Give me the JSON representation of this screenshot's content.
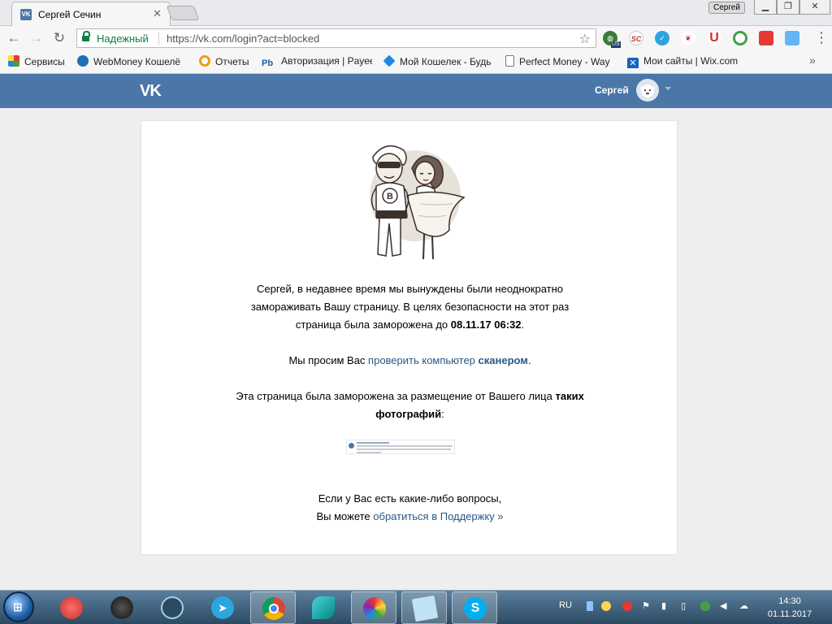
{
  "browser": {
    "tab_title": "Сергей Сечин",
    "tab_close": "✕",
    "profile_name": "Сергей",
    "omnibox": {
      "secure_label": "Надежный",
      "url": "https://vk.com/login?act=blocked"
    },
    "extensions": [
      "globe-us",
      "sc",
      "check",
      "heart",
      "magnet",
      "green-ring",
      "cube",
      "map"
    ],
    "ext_badge": "US",
    "bookmarks": [
      {
        "label": "Сервисы",
        "icon": "apps-grid"
      },
      {
        "label": "WebMoney Кошелё",
        "icon": "globe"
      },
      {
        "label": "Отчеты",
        "icon": "q-orange"
      },
      {
        "label": "Авторизация | Payee",
        "icon": "pb"
      },
      {
        "label": "Мой Кошелек - Будь",
        "icon": "diamond"
      },
      {
        "label": "Perfect Money - Way",
        "icon": "document"
      },
      {
        "label": "Мои сайты | Wix.com",
        "icon": "x-blue"
      }
    ],
    "bookmarks_more": "»"
  },
  "vk": {
    "logo": "VK",
    "user_name": "Сергей",
    "message": {
      "line1": "Сергей, в недавнее время мы вынуждены были неоднократно",
      "line2": "замораживать Вашу страницу. В целях безопасности на этот раз",
      "line3_prefix": "страница была заморожена до ",
      "date": "08.11.17 06:32",
      "line3_suffix": "."
    },
    "scan": {
      "prefix": "Мы просим Вас ",
      "link": "проверить компьютер",
      "space": " ",
      "bold_link": "сканером",
      "suffix": "."
    },
    "reason": {
      "line1": "Эта страница была заморожена за размещение от Вашего лица ",
      "bold1": "таких",
      "bold2": "фотографий",
      "suffix": ":"
    },
    "support": {
      "line1": "Если у Вас есть какие-либо вопросы,",
      "prefix": "Вы можете ",
      "link": "обратиться в Поддержку »"
    }
  },
  "taskbar": {
    "apps": [
      "red-record",
      "speedometer",
      "atom",
      "telegram",
      "chrome",
      "bird",
      "mosaic",
      "notepad",
      "skype"
    ],
    "active_app": "chrome",
    "lang": "RU",
    "time": "14:30",
    "date": "01.11.2017"
  }
}
